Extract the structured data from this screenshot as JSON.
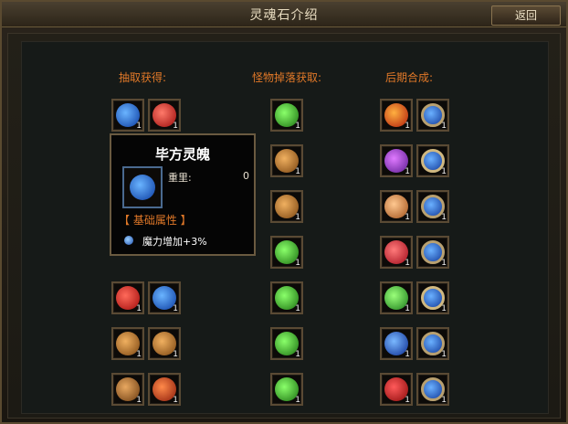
{
  "window": {
    "title": "灵魂石介绍",
    "back_label": "返回"
  },
  "columns": [
    {
      "header": "抽取获得:"
    },
    {
      "header": "怪物掉落获取:"
    },
    {
      "header": "后期合成:"
    }
  ],
  "slot_count": "1",
  "tooltip": {
    "name": "毕方灵魄",
    "weight_label": "重里:",
    "weight_value": "0",
    "attr_header": "【 基础属性 】",
    "effect": "魔力增加+3%"
  },
  "colors": {
    "header": "#e07828",
    "frame": "#5a4a34",
    "background": "#161a18"
  },
  "icons": {
    "draw_col": [
      "blue-dragon-orb",
      "red-dragon-orb",
      "red-orb",
      "blue-orb",
      "bronze-dragon-orb",
      "bronze-dragon-orb",
      "bronze-beast-orb",
      "red-beast-orb"
    ],
    "drop_col": [
      "green-beast-orb",
      "bronze-dragon-orb",
      "bronze-dragon-orb",
      "green-dragon-orb",
      "green-dragon-orb",
      "green-dragon-orb",
      "green-dragon-orb"
    ],
    "synth_col": [
      "fire-orb",
      "gold-ring-blue-gem",
      "purple-orb",
      "winged-blue-gem",
      "orange-orb",
      "gold-ring-blue-gem",
      "red-orb",
      "gold-ring-blue-gem",
      "green-orb",
      "winged-blue-gem",
      "blue-orb",
      "gold-ring-blue-gem",
      "red-orb",
      "gold-ring-blue-gem"
    ]
  }
}
